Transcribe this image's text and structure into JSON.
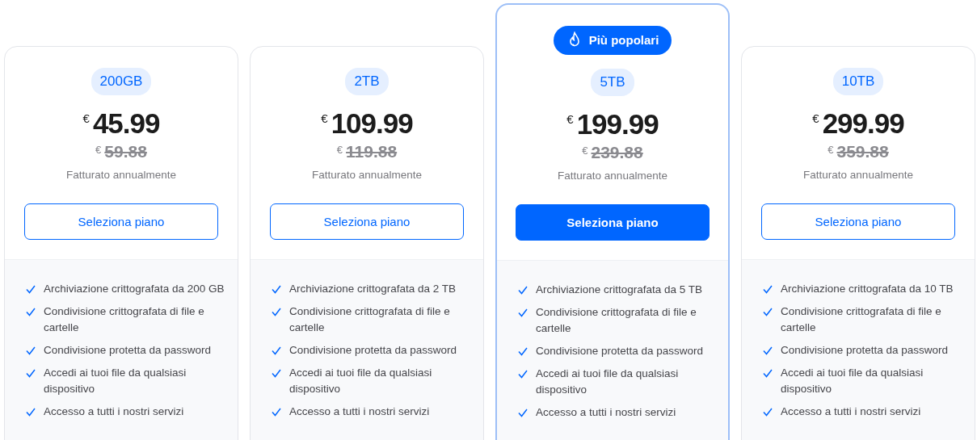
{
  "plans": [
    {
      "size": "200GB",
      "currency": "€",
      "price": "45.99",
      "old_price": "59.88",
      "billing": "Fatturato annualmente",
      "button": "Seleziona piano",
      "selected": false,
      "features": [
        "Archiviazione crittografata da 200 GB",
        "Condivisione crittografata di file e cartelle",
        "Condivisione protetta da password",
        "Accedi ai tuoi file da qualsiasi dispositivo",
        "Accesso a tutti i nostri servizi"
      ]
    },
    {
      "size": "2TB",
      "currency": "€",
      "price": "109.99",
      "old_price": "119.88",
      "billing": "Fatturato annualmente",
      "button": "Seleziona piano",
      "selected": false,
      "features": [
        "Archiviazione crittografata da 2 TB",
        "Condivisione crittografata di file e cartelle",
        "Condivisione protetta da password",
        "Accedi ai tuoi file da qualsiasi dispositivo",
        "Accesso a tutti i nostri servizi"
      ]
    },
    {
      "badge": "Più popolari",
      "size": "5TB",
      "currency": "€",
      "price": "199.99",
      "old_price": "239.88",
      "billing": "Fatturato annualmente",
      "button": "Seleziona piano",
      "selected": true,
      "features": [
        "Archiviazione crittografata da 5 TB",
        "Condivisione crittografata di file e cartelle",
        "Condivisione protetta da password",
        "Accedi ai tuoi file da qualsiasi dispositivo",
        "Accesso a tutti i nostri servizi"
      ]
    },
    {
      "size": "10TB",
      "currency": "€",
      "price": "299.99",
      "old_price": "359.88",
      "billing": "Fatturato annualmente",
      "button": "Seleziona piano",
      "selected": false,
      "features": [
        "Archiviazione crittografata da 10 TB",
        "Condivisione crittografata di file e cartelle",
        "Condivisione protetta da password",
        "Accedi ai tuoi file da qualsiasi dispositivo",
        "Accesso a tutti i nostri servizi"
      ]
    }
  ]
}
